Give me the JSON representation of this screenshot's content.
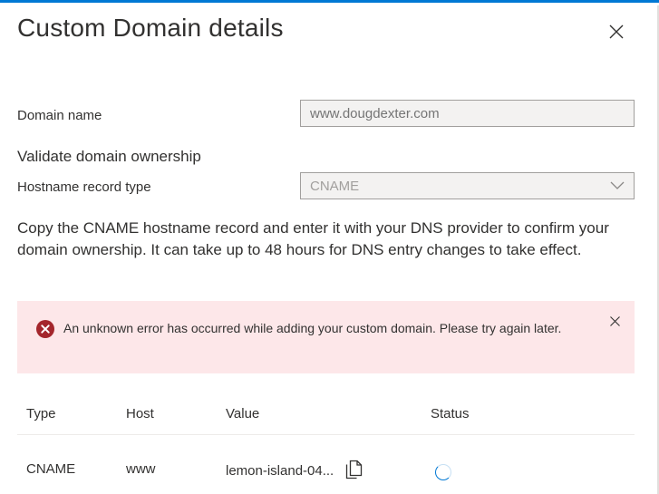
{
  "dialog": {
    "title": "Custom Domain details",
    "close_icon": "close-icon"
  },
  "domain": {
    "label": "Domain name",
    "placeholder": "www.dougdexter.com",
    "value": ""
  },
  "validate": {
    "section_title": "Validate domain ownership",
    "record_type_label": "Hostname record type",
    "record_type_value": "CNAME",
    "dropdown_icon": "chevron-down-icon"
  },
  "description": "Copy the CNAME hostname record and enter it with your DNS provider to confirm your domain ownership. It can take up to 48 hours for DNS entry changes to take effect.",
  "error": {
    "icon": "error-circle-icon",
    "message": "An unknown error has occurred while adding your custom domain. Please try again later.",
    "dismiss_icon": "close-icon",
    "background": "#fde7e9",
    "icon_color": "#a4262c"
  },
  "table": {
    "headers": [
      "Type",
      "Host",
      "Value",
      "Status"
    ],
    "rows": [
      {
        "type": "CNAME",
        "host": "www",
        "value": "lemon-island-04...",
        "copy_icon": "copy-icon",
        "status_icon": "spinner-icon"
      }
    ]
  },
  "colors": {
    "accent": "#0078d4",
    "text": "#323130",
    "disabled_text": "#a19f9d"
  }
}
